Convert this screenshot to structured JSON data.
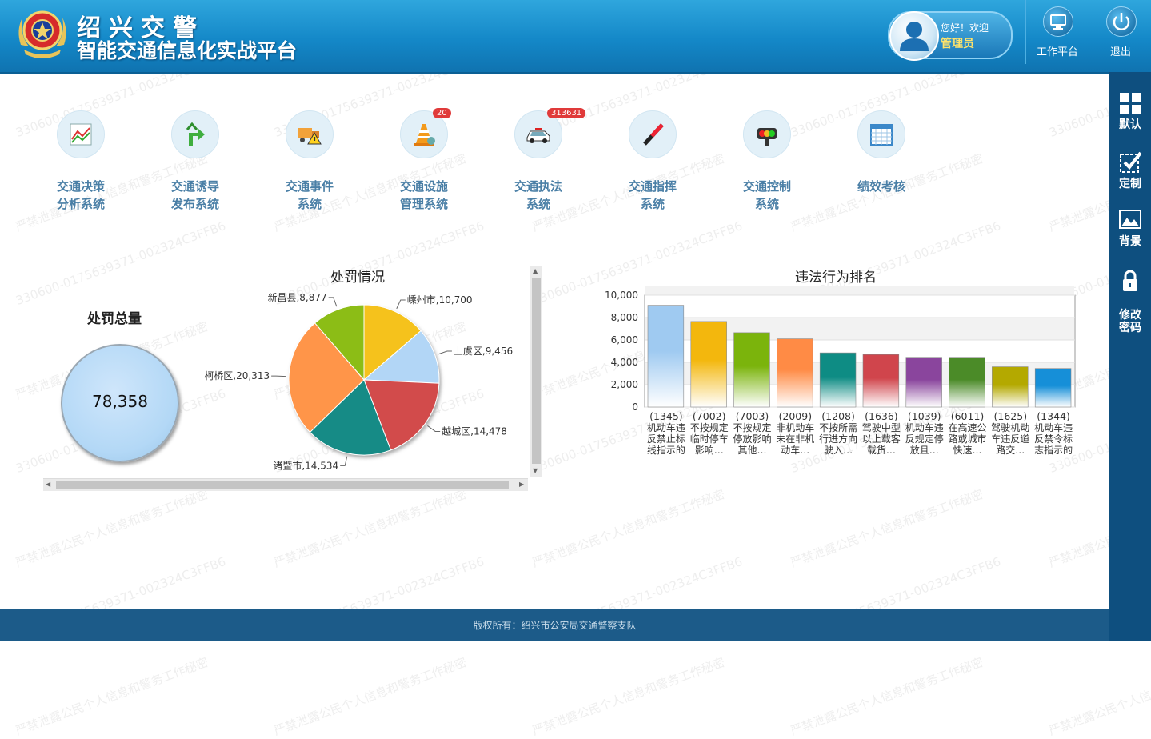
{
  "header": {
    "title_line1": "绍兴交警",
    "title_line2": "智能交通信息化实战平台",
    "greeting": "您好！欢迎",
    "username": "管理员",
    "workbench_label": "工作平台",
    "logout_label": "退出"
  },
  "sidebar": {
    "items": [
      {
        "label": "默认",
        "icon": "grid-icon"
      },
      {
        "label": "定制",
        "icon": "checkbox-icon"
      },
      {
        "label": "背景",
        "icon": "picture-icon"
      },
      {
        "label": "修改\n密码",
        "icon": "lock-icon"
      }
    ]
  },
  "systems": [
    {
      "line1": "交通决策",
      "line2": "分析系统",
      "icon": "chart-icon",
      "badge": ""
    },
    {
      "line1": "交通诱导",
      "line2": "发布系统",
      "icon": "sign-arrow-icon",
      "badge": ""
    },
    {
      "line1": "交通事件",
      "line2": "系统",
      "icon": "truck-warning-icon",
      "badge": ""
    },
    {
      "line1": "交通设施",
      "line2": "管理系统",
      "icon": "traffic-cone-icon",
      "badge": "20"
    },
    {
      "line1": "交通执法",
      "line2": "系统",
      "icon": "police-car-icon",
      "badge": "313631"
    },
    {
      "line1": "交通指挥",
      "line2": "系统",
      "icon": "baton-icon",
      "badge": ""
    },
    {
      "line1": "交通控制",
      "line2": "系统",
      "icon": "traffic-light-icon",
      "badge": ""
    },
    {
      "line1": "绩效考核",
      "line2": "",
      "icon": "calendar-icon",
      "badge": ""
    }
  ],
  "total_panel": {
    "title": "处罚总量",
    "value": "78,358"
  },
  "chart_data": [
    {
      "type": "pie",
      "title": "处罚情况",
      "slices": [
        {
          "label": "嵊州市",
          "value": 10700,
          "color": "#f5c21b"
        },
        {
          "label": "上虞区",
          "value": 9456,
          "color": "#b2d6f6"
        },
        {
          "label": "越城区",
          "value": 14478,
          "color": "#d24b4b"
        },
        {
          "label": "诸暨市",
          "value": 14534,
          "color": "#168b86"
        },
        {
          "label": "柯桥区",
          "value": 20313,
          "color": "#ff9548"
        },
        {
          "label": "新昌县",
          "value": 8877,
          "color": "#8cbd19"
        }
      ]
    },
    {
      "type": "bar",
      "title": "违法行为排名",
      "ylim": [
        0,
        10000
      ],
      "yticks": [
        "0",
        "2,000",
        "4,000",
        "6,000",
        "8,000",
        "10,000"
      ],
      "grid": true,
      "categories": [
        {
          "code": "(1345)",
          "l1": "机动车违",
          "l2": "反禁止标",
          "l3": "线指示的"
        },
        {
          "code": "(7002)",
          "l1": "不按规定",
          "l2": "临时停车",
          "l3": "影响…"
        },
        {
          "code": "(7003)",
          "l1": "不按规定",
          "l2": "停放影响",
          "l3": "其他…"
        },
        {
          "code": "(2009)",
          "l1": "非机动车",
          "l2": "未在非机",
          "l3": "动车…"
        },
        {
          "code": "(1208)",
          "l1": "不按所需",
          "l2": "行进方向",
          "l3": "驶入…"
        },
        {
          "code": "(1636)",
          "l1": "驾驶中型",
          "l2": "以上载客",
          "l3": "载货…"
        },
        {
          "code": "(1039)",
          "l1": "机动车违",
          "l2": "反规定停",
          "l3": "放且…"
        },
        {
          "code": "(6011)",
          "l1": "在高速公",
          "l2": "路或城市",
          "l3": "快速…"
        },
        {
          "code": "(1625)",
          "l1": "驾驶机动",
          "l2": "车违反道",
          "l3": "路交…"
        },
        {
          "code": "(1344)",
          "l1": "机动车违",
          "l2": "反禁令标",
          "l3": "志指示的"
        }
      ],
      "values": [
        9100,
        7650,
        6650,
        6100,
        4850,
        4700,
        4450,
        4450,
        3600,
        3450
      ],
      "colors": [
        [
          "#9fcaf1",
          "#ffffff"
        ],
        [
          "#f3b70d",
          "#ffffff"
        ],
        [
          "#7bb40c",
          "#ffffff"
        ],
        [
          "#ff8b45",
          "#ffffff"
        ],
        [
          "#0e8c84",
          "#ffffff"
        ],
        [
          "#d0454c",
          "#ffffff"
        ],
        [
          "#8a459d",
          "#ffffff"
        ],
        [
          "#4b8b28",
          "#ffffff"
        ],
        [
          "#b4a900",
          "#ffffff"
        ],
        [
          "#168fd8",
          "#ffffff"
        ]
      ]
    }
  ],
  "footer": {
    "text": "版权所有：绍兴市公安局交通警察支队"
  },
  "watermark": {
    "id_text": "330600-0175639371-002324C3FFB6",
    "warning_text": "严禁泄露公民个人信息和警务工作秘密"
  }
}
